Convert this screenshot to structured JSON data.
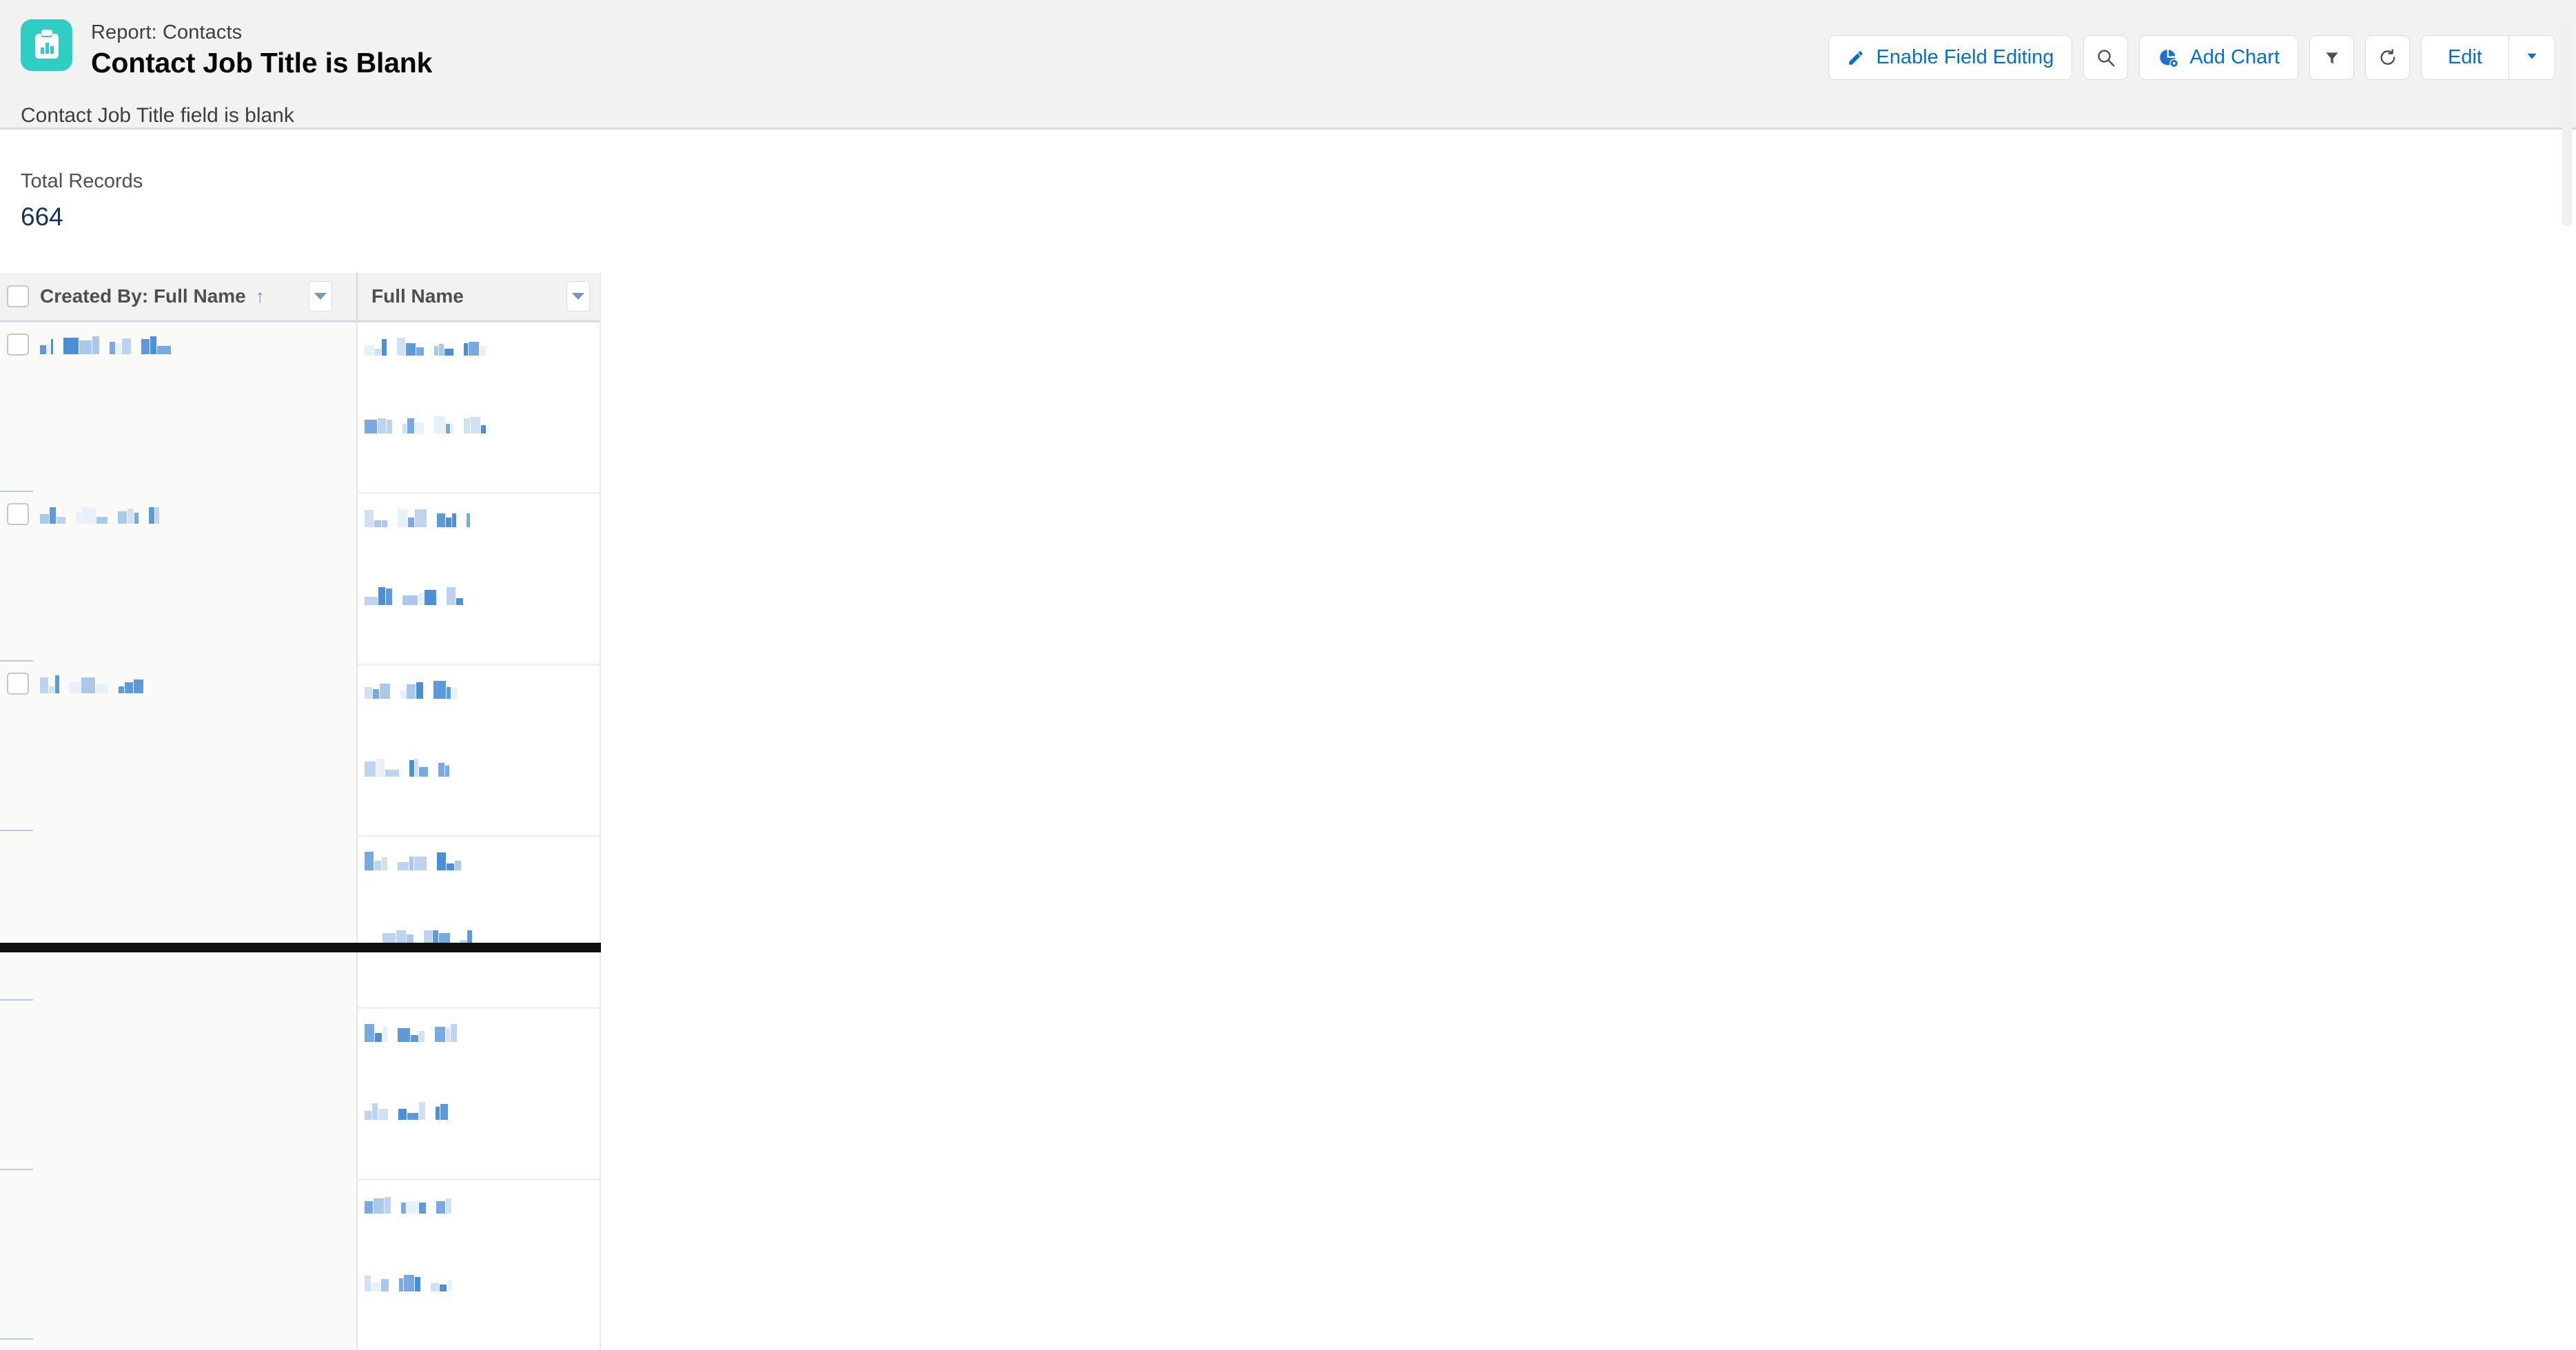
{
  "header": {
    "eyebrow": "Report: Contacts",
    "title": "Contact Job Title is Blank",
    "subtitle": "Contact Job Title field is blank",
    "icon": "report-clipboard-chart-icon",
    "icon_color": "#2ecec4"
  },
  "toolbar": {
    "enable_field_editing_label": "Enable Field Editing",
    "search_label": "",
    "add_chart_label": "Add Chart",
    "filter_label": "",
    "refresh_label": "",
    "edit_label": "Edit",
    "edit_menu_label": "",
    "accent_color": "#0070d2",
    "icons": {
      "pencil": "pencil-icon",
      "search": "search-icon",
      "add_chart": "pie-chart-add-icon",
      "filter": "filter-icon",
      "refresh": "refresh-icon",
      "caret": "chevron-down-icon"
    }
  },
  "summary": {
    "label": "Total Records",
    "value": "664",
    "value_color": "#16325c"
  },
  "table": {
    "columns": [
      {
        "label": "Created By: Full Name",
        "sorted": true,
        "sort_direction": "↑",
        "menu": "column-menu-icon"
      },
      {
        "label": "Full Name",
        "sorted": false,
        "sort_direction": "",
        "menu": "column-menu-icon"
      }
    ],
    "select_all_checkbox": "unchecked",
    "redacted": true,
    "redaction_note": "Record values are pixelated/obscured in the screenshot",
    "groups": [
      {
        "group_label_redacted": true,
        "group_label_widths": [
          9,
          5,
          3,
          22,
          18,
          10,
          8,
          8,
          13,
          12,
          9,
          20
        ],
        "rows": [
          {
            "full_name_widths": [
              14,
              9,
              7,
              12,
              14,
              11,
              6,
              7,
              13,
              6,
              15,
              9
            ]
          },
          {
            "full_name_widths": [
              18,
              12,
              8,
              6,
              10,
              13,
              16,
              6,
              4,
              9,
              14,
              7
            ]
          }
        ]
      },
      {
        "group_label_redacted": true,
        "group_label_widths": [
          13,
          9,
          13,
          8,
          20,
          16,
          13,
          9,
          6,
          8,
          6
        ],
        "rows": [
          {
            "full_name_widths": [
              13,
              10,
              8,
              14,
              9,
              17,
              12,
              8,
              6,
              5
            ]
          },
          {
            "full_name_widths": [
              19,
              10,
              9,
              22,
              8,
              17,
              13,
              10
            ]
          }
        ]
      },
      {
        "group_label_redacted": true,
        "group_label_widths": [
          12,
          8,
          6,
          16,
          20,
          18,
          8,
          12,
          14
        ],
        "rows": [
          {
            "full_name_widths": [
              11,
              9,
              15,
              8,
              13,
              10,
              18,
              6,
              9
            ]
          },
          {
            "full_name_widths": [
              16,
              12,
              20,
              7,
              5,
              13,
              9,
              6
            ]
          }
        ]
      },
      {
        "group_label_redacted": false,
        "group_label_widths": [],
        "rows": [
          {
            "full_name_widths": [
              13,
              10,
              8,
              16,
              6,
              18,
              13,
              11,
              9
            ]
          },
          {
            "full_name_widths": [
              19,
              14,
              10,
              12,
              8,
              16,
              9,
              7
            ]
          }
        ]
      },
      {
        "group_label_redacted": false,
        "group_label_widths": [],
        "rows": [
          {
            "full_name_widths": [
              14,
              10,
              7,
              18,
              11,
              8,
              15,
              6,
              9
            ]
          },
          {
            "full_name_widths": [
              10,
              8,
              14,
              12,
              16,
              9,
              6,
              11
            ]
          }
        ]
      },
      {
        "group_label_redacted": false,
        "group_label_widths": [],
        "rows": [
          {
            "full_name_widths": [
              12,
              15,
              9,
              7,
              17,
              10,
              13,
              8
            ]
          },
          {
            "full_name_widths": [
              9,
              13,
              11,
              6,
              15,
              8,
              12,
              10,
              7
            ]
          }
        ]
      }
    ]
  },
  "scroll": {
    "horizontal_position": "left",
    "vertical_position": "top"
  }
}
